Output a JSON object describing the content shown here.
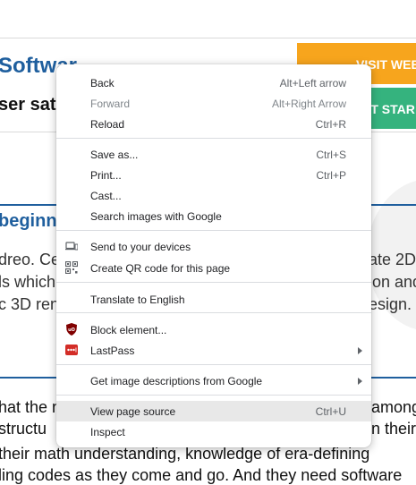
{
  "background": {
    "heading_partial": "Softwar",
    "subheading_partial": "ser satis",
    "visit_button": "VISIT WEB",
    "start_button": "ET STAR",
    "section_partial": "beginn",
    "paragraph": [
      "dreo. Ce",
      "ls which",
      "c 3D ren"
    ],
    "paragraph_right": [
      "ate 2D",
      "ion and",
      "esign."
    ],
    "lower_left": [
      "hat the n",
      "structu",
      "their math understanding, knowledge of era-defining",
      "ling codes as they come and go. And they need software"
    ],
    "lower_right": [
      "among",
      "n their"
    ]
  },
  "context_menu": {
    "groups": [
      [
        {
          "label": "Back",
          "shortcut": "Alt+Left arrow"
        },
        {
          "label": "Forward",
          "shortcut": "Alt+Right Arrow",
          "disabled": true
        },
        {
          "label": "Reload",
          "shortcut": "Ctrl+R"
        }
      ],
      [
        {
          "label": "Save as...",
          "shortcut": "Ctrl+S"
        },
        {
          "label": "Print...",
          "shortcut": "Ctrl+P"
        },
        {
          "label": "Cast...",
          "shortcut": ""
        },
        {
          "label": "Search images with Google",
          "shortcut": ""
        }
      ],
      [
        {
          "label": "Send to your devices",
          "icon": "devices-icon"
        },
        {
          "label": "Create QR code for this page",
          "icon": "qr-code-icon"
        }
      ],
      [
        {
          "label": "Translate to English"
        }
      ],
      [
        {
          "label": "Block element...",
          "icon": "ublock-icon"
        },
        {
          "label": "LastPass",
          "icon": "lastpass-icon",
          "submenu": true
        }
      ],
      [
        {
          "label": "Get image descriptions from Google",
          "submenu": true
        }
      ],
      [
        {
          "label": "View page source",
          "shortcut": "Ctrl+U",
          "highlighted": true
        },
        {
          "label": "Inspect"
        }
      ]
    ]
  },
  "colors": {
    "brand_blue": "#1f5f9e",
    "visit_orange": "#f7a51d",
    "start_green": "#35b37e",
    "ublock_red": "#800000",
    "lastpass_red": "#d32d27",
    "hover_gray": "#e8e8e8"
  }
}
